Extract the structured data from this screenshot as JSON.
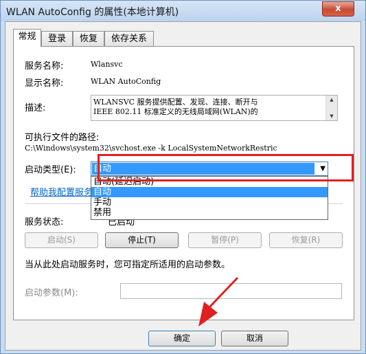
{
  "window": {
    "title": "WLAN AutoConfig 的属性(本地计算机)",
    "close_label": "x"
  },
  "tabs": [
    {
      "label": "常规",
      "active": true
    },
    {
      "label": "登录",
      "active": false
    },
    {
      "label": "恢复",
      "active": false
    },
    {
      "label": "依存关系",
      "active": false
    }
  ],
  "general": {
    "service_name_label": "服务名称:",
    "service_name": "Wlansvc",
    "display_name_label": "显示名称:",
    "display_name": "WLAN AutoConfig",
    "description_label": "描述:",
    "description": "WLANSVC 服务提供配置、发现、连接、断开与\nIEEE 802.11 标准定义的无线局域网(WLAN)的",
    "exe_path_label": "可执行文件的路径:",
    "exe_path": "C:\\Windows\\system32\\svchost.exe -k LocalSystemNetworkRestric",
    "startup_type_label": "启动类型(E):",
    "startup_type_value": "自动",
    "startup_options": [
      "自动(延迟启动)",
      "自动",
      "手动",
      "禁用"
    ],
    "help_link": "帮助我配置服务启",
    "status_label": "服务状态:",
    "status_value": "已启动",
    "buttons": {
      "start": "启动(S)",
      "stop": "停止(T)",
      "pause": "暂停(P)",
      "resume": "恢复(R)"
    },
    "hint": "当从此处启动服务时，您可指定所适用的启动参数。",
    "param_label": "启动参数(M):",
    "param_value": ""
  },
  "footer": {
    "ok": "确定",
    "cancel": "取消"
  },
  "colors": {
    "selection": "#3399ff",
    "highlight_box": "#e02020",
    "link": "#0066cc"
  }
}
